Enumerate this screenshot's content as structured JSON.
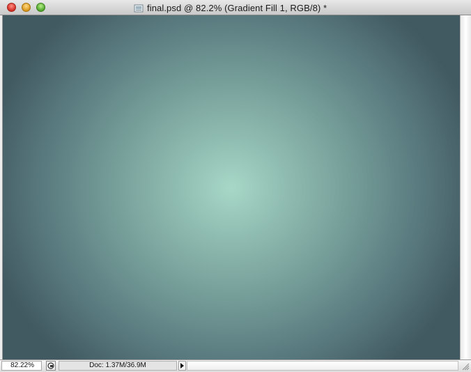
{
  "window": {
    "title": "final.psd @ 82.2% (Gradient Fill 1, RGB/8) *",
    "controls": [
      "close-button",
      "minimize-button",
      "zoom-button"
    ]
  },
  "canvas": {
    "fill": "radial-gradient",
    "center_color": "#a7d8c7",
    "edge_color": "#415961"
  },
  "statusbar": {
    "zoom_value": "82.22%",
    "doc_info": "Doc: 1.37M/36.9M"
  },
  "colors": {
    "titlebar": "#cfcfcf",
    "close": "#d32d22",
    "minimize": "#d99618",
    "maximize": "#4fa52b"
  },
  "icons": {
    "document": "psd-document-icon",
    "status_menu": "status-menu-icon",
    "arrow": "play-arrow-icon",
    "resize": "resize-grip-icon"
  }
}
